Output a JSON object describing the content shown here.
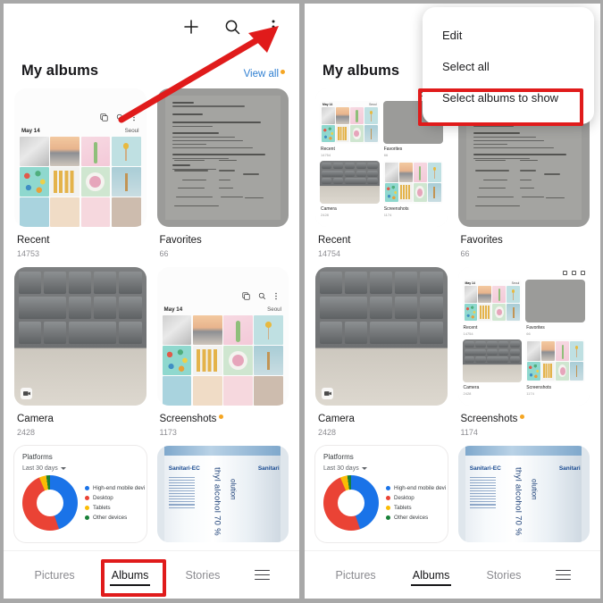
{
  "app": {
    "screen_title": "My albums",
    "view_all_label": "View all"
  },
  "appbar": {
    "add_icon": "plus-icon",
    "search_icon": "search-icon",
    "more_icon": "more-vertical-icon"
  },
  "albums_left": [
    {
      "name": "Recent",
      "count": "14753",
      "badge": false
    },
    {
      "name": "Favorites",
      "count": "66",
      "badge": false
    },
    {
      "name": "Camera",
      "count": "2428",
      "badge": false
    },
    {
      "name": "Screenshots",
      "count": "1173",
      "badge": true
    }
  ],
  "albums_right": [
    {
      "name": "Recent",
      "count": "14754",
      "badge": false
    },
    {
      "name": "Favorites",
      "count": "66",
      "badge": false
    },
    {
      "name": "Camera",
      "count": "2428",
      "badge": false
    },
    {
      "name": "Screenshots",
      "count": "1174",
      "badge": true
    }
  ],
  "gallery_thumb": {
    "date": "May 14",
    "location": "Seoul"
  },
  "chart_data": {
    "type": "pie",
    "title": "Platforms",
    "range_label": "Last 30 days",
    "categories": [
      "High-end mobile devi",
      "Desktop",
      "Tablets",
      "Other devices"
    ],
    "values": [
      44,
      48,
      4,
      2
    ],
    "colors": [
      "#1a73e8",
      "#ea4335",
      "#fbbc04",
      "#188038"
    ],
    "legend_position": "right",
    "xlabel": "",
    "ylabel": ""
  },
  "bottle_card": {
    "brand": "Sanitari-EC",
    "brand_right": "Sanitari",
    "main_text": "thyl alcohol 70 %",
    "sub_text": "olution"
  },
  "menu": {
    "items": [
      {
        "label": "Edit",
        "highlighted": false
      },
      {
        "label": "Select all",
        "highlighted": false
      },
      {
        "label": "Select albums to show",
        "highlighted": true
      }
    ]
  },
  "bottom_nav": {
    "items": [
      {
        "label": "Pictures",
        "active": false
      },
      {
        "label": "Albums",
        "active": true
      },
      {
        "label": "Stories",
        "active": false
      }
    ],
    "menu_icon": "hamburger-icon"
  },
  "annotations": {
    "accent_color": "#e01b1b",
    "badge_color": "#f5a623",
    "link_color": "#2f7fd1"
  }
}
